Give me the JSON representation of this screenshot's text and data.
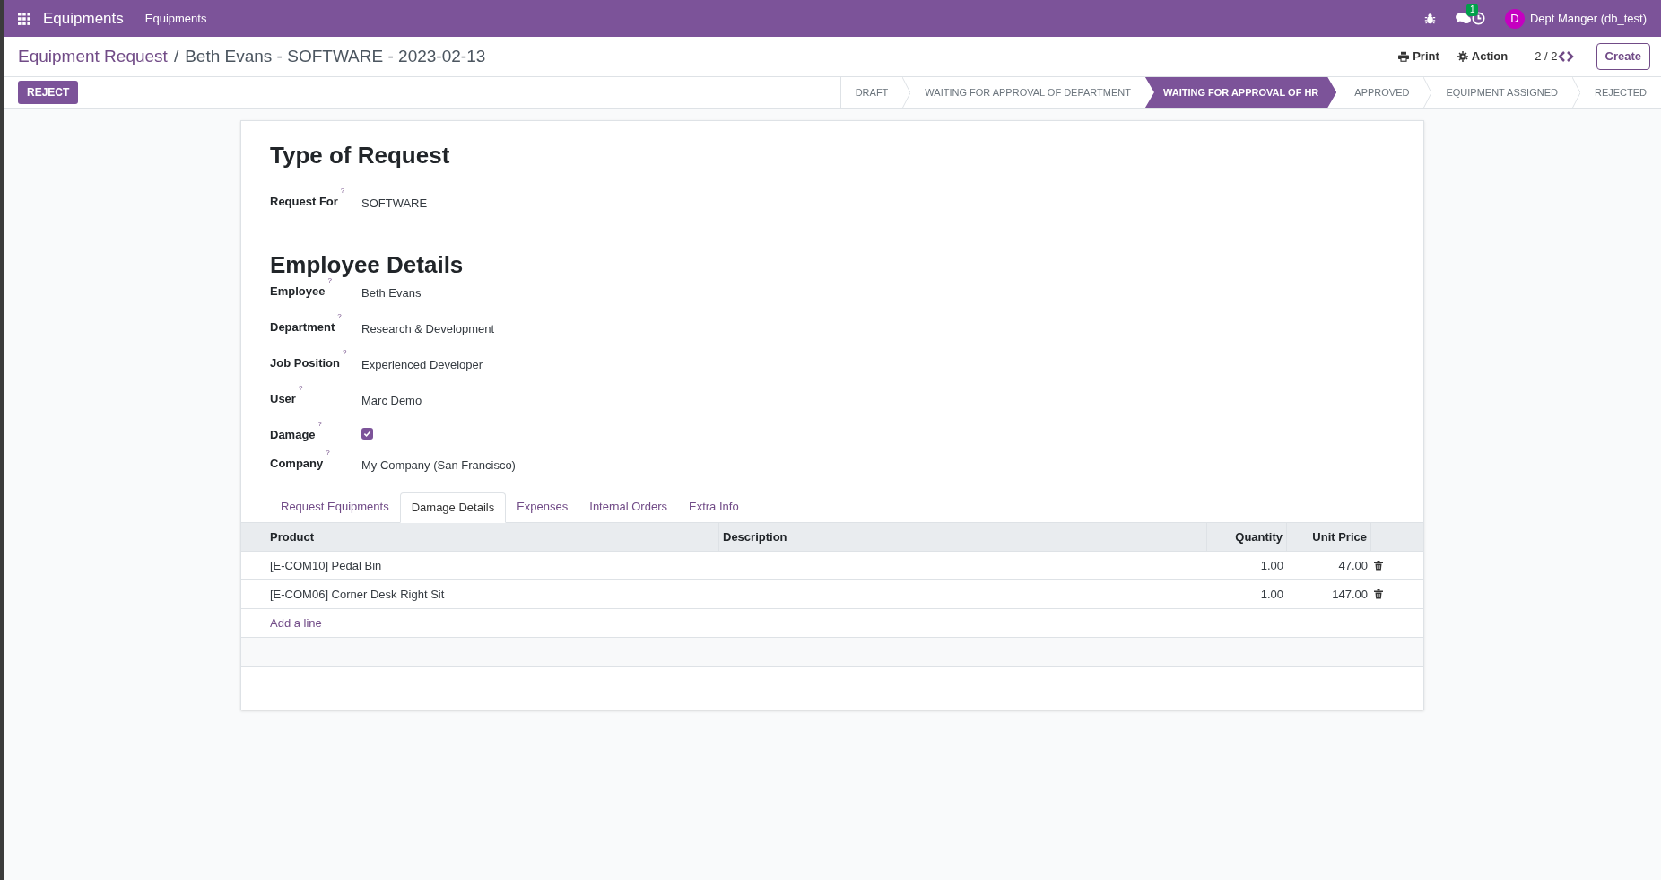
{
  "navbar": {
    "app_name": "Equipments",
    "menu": [
      "Equipments"
    ],
    "messages_badge": "1",
    "user_initial": "D",
    "user_name": "Dept Manger (db_test)"
  },
  "breadcrumb": {
    "parent": "Equipment Request",
    "separator": "/",
    "current": "Beth Evans - SOFTWARE - 2023-02-13"
  },
  "actions": {
    "print": "Print",
    "action": "Action",
    "pager": "2 / 2",
    "create": "Create"
  },
  "header_buttons": [
    "REJECT"
  ],
  "stages": [
    {
      "label": "DRAFT",
      "selected": false
    },
    {
      "label": "WAITING FOR APPROVAL OF DEPARTMENT",
      "selected": false
    },
    {
      "label": "WAITING FOR APPROVAL OF HR",
      "selected": true
    },
    {
      "label": "APPROVED",
      "selected": false
    },
    {
      "label": "EQUIPMENT ASSIGNED",
      "selected": false
    },
    {
      "label": "REJECTED",
      "selected": false
    }
  ],
  "sections": [
    {
      "title": "Type of Request",
      "fields": [
        {
          "kind": "text",
          "label": "Request For",
          "help": "?",
          "value": "SOFTWARE"
        }
      ]
    },
    {
      "title": "Employee Details",
      "fields": [
        {
          "kind": "text",
          "label": "Employee",
          "help": "?",
          "value": "Beth Evans"
        },
        {
          "kind": "text",
          "label": "Department",
          "help": "?",
          "value": "Research & Development"
        },
        {
          "kind": "text",
          "label": "Job Position",
          "help": "?",
          "value": "Experienced Developer"
        },
        {
          "kind": "text",
          "label": "User",
          "help": "?",
          "value": "Marc Demo"
        },
        {
          "kind": "checkbox",
          "label": "Damage",
          "help": "?",
          "checked": true
        },
        {
          "kind": "text",
          "label": "Company",
          "help": "?",
          "value": "My Company (San Francisco)"
        }
      ]
    }
  ],
  "tabs": [
    {
      "label": "Request Equipments",
      "selected": false
    },
    {
      "label": "Damage Details",
      "selected": true
    },
    {
      "label": "Expenses",
      "selected": false
    },
    {
      "label": "Internal Orders",
      "selected": false
    },
    {
      "label": "Extra Info",
      "selected": false
    }
  ],
  "table": {
    "columns": [
      "Product",
      "Description",
      "Quantity",
      "Unit Price"
    ],
    "rows": [
      {
        "product": "[E-COM10] Pedal Bin",
        "quantity": "1.00",
        "unit_price": "47.00"
      },
      {
        "product": "[E-COM06] Corner Desk Right Sit",
        "quantity": "1.00",
        "unit_price": "147.00"
      }
    ],
    "add_line": "Add a line"
  }
}
